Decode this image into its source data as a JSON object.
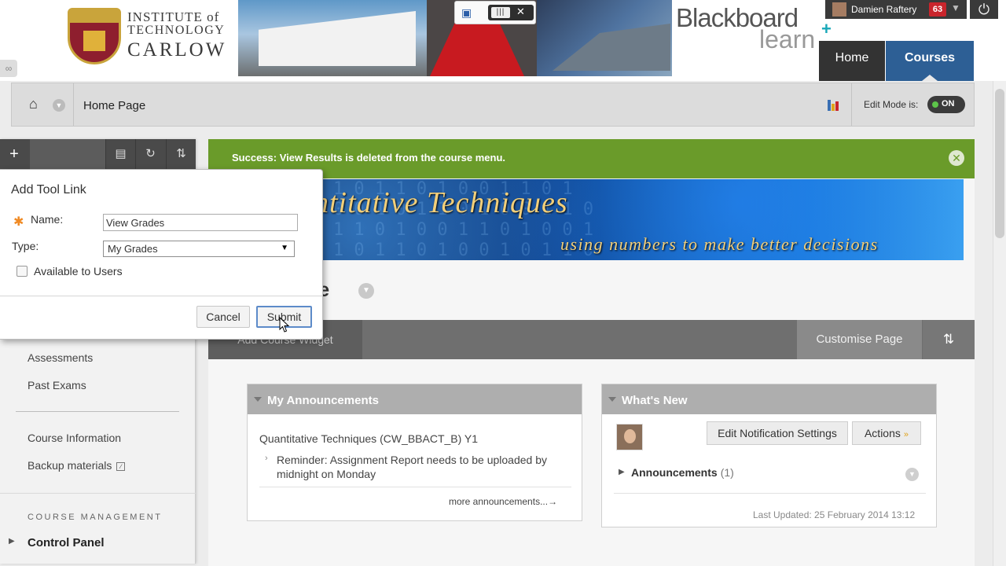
{
  "header": {
    "institution_line1": "INSTITUTE of",
    "institution_line2": "TECHNOLOGY",
    "institution_line3": "CARLOW",
    "brand_name": "Blackboard",
    "brand_sub": "learn",
    "brand_plus": "+",
    "user_name": "Damien Raftery",
    "notification_count": "63",
    "tabs": [
      {
        "label": "Home",
        "active": false
      },
      {
        "label": "Courses",
        "active": true
      }
    ]
  },
  "breadcrumb": {
    "current": "Home Page",
    "edit_mode_label": "Edit Mode is:",
    "edit_mode_value": "ON"
  },
  "left_menu": {
    "items": [
      {
        "label": "Assessments"
      },
      {
        "label": "Past Exams"
      },
      {
        "label": "Course Information"
      },
      {
        "label": "Backup materials"
      }
    ],
    "section_heading": "COURSE MANAGEMENT",
    "control_panel": "Control Panel"
  },
  "dialog": {
    "title": "Add Tool Link",
    "name_label": "Name:",
    "name_value": "View Grades",
    "type_label": "Type:",
    "type_value": "My Grades",
    "available_label": "Available to Users",
    "available_checked": false,
    "cancel_label": "Cancel",
    "submit_label": "Submit"
  },
  "content": {
    "success_message": "Success: View Results is deleted from the course menu.",
    "banner_title": "antitative Techniques",
    "banner_subtitle": "using numbers to make better decisions",
    "page_title": "ge",
    "widget_bar": {
      "add_widget": "Add Course Widget",
      "customise": "Customise Page"
    },
    "announcements": {
      "title": "My Announcements",
      "course": "Quantitative Techniques (CW_BBACT_B) Y1",
      "item": "Reminder: Assignment Report needs to be uploaded by midnight on Monday",
      "more": "more announcements...→"
    },
    "whats_new": {
      "title": "What's New",
      "edit_notifications": "Edit Notification Settings",
      "actions": "Actions",
      "row_label": "Announcements",
      "row_count": "(1)",
      "last_updated": "Last Updated: 25 February 2014 13:12"
    }
  },
  "colors": {
    "success_green": "#6a9b2a",
    "courses_tab": "#2d5f95",
    "badge_red": "#c9252c",
    "toggle_on": "#5dc44a",
    "required_star": "#f08a24"
  },
  "icons": {
    "home": "home-icon",
    "power": "power-icon",
    "plus": "plus-icon",
    "folder": "folder-icon",
    "refresh": "refresh-icon",
    "sort": "sort-icon",
    "close": "close-icon"
  }
}
